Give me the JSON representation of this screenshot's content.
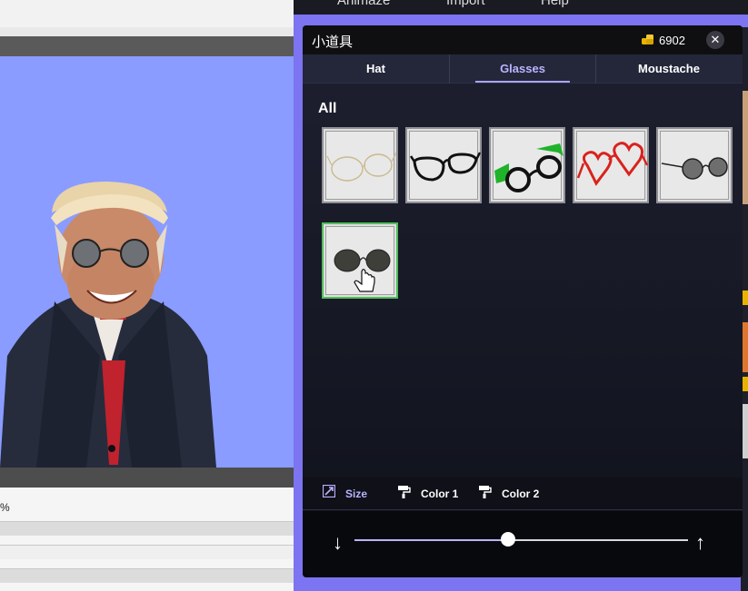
{
  "topmenu": {
    "items": [
      "Animaze",
      "Import",
      "Help"
    ]
  },
  "background": {
    "fragment": "%"
  },
  "panel": {
    "title": "小道具",
    "coins": "6902",
    "close_glyph": "✕",
    "tabs": [
      {
        "label": "Hat",
        "active": false
      },
      {
        "label": "Glasses",
        "active": true
      },
      {
        "label": "Moustache",
        "active": false
      }
    ],
    "section_title": "All",
    "items": [
      {
        "name": "thin gold wire glasses",
        "selected": false
      },
      {
        "name": "black rectangle glasses",
        "selected": false
      },
      {
        "name": "green and black glasses",
        "selected": false
      },
      {
        "name": "red heart glasses",
        "selected": false
      },
      {
        "name": "round grey sunglasses",
        "selected": false
      },
      {
        "name": "round dark sunglasses",
        "selected": true
      }
    ],
    "toolbar": [
      {
        "label": "Size",
        "icon": "resize-icon",
        "active": true
      },
      {
        "label": "Color 1",
        "icon": "paint-roller-1-icon",
        "active": false
      },
      {
        "label": "Color 2",
        "icon": "paint-roller-2-icon",
        "active": false
      }
    ],
    "slider": {
      "value": 0.46,
      "decrease_glyph": "↓",
      "increase_glyph": "↑"
    }
  },
  "colors": {
    "accent": "#b9b4ff",
    "selected_border": "#4fbf5a",
    "viewport_bg": "#8a9cff",
    "gold": "#e8b400"
  }
}
